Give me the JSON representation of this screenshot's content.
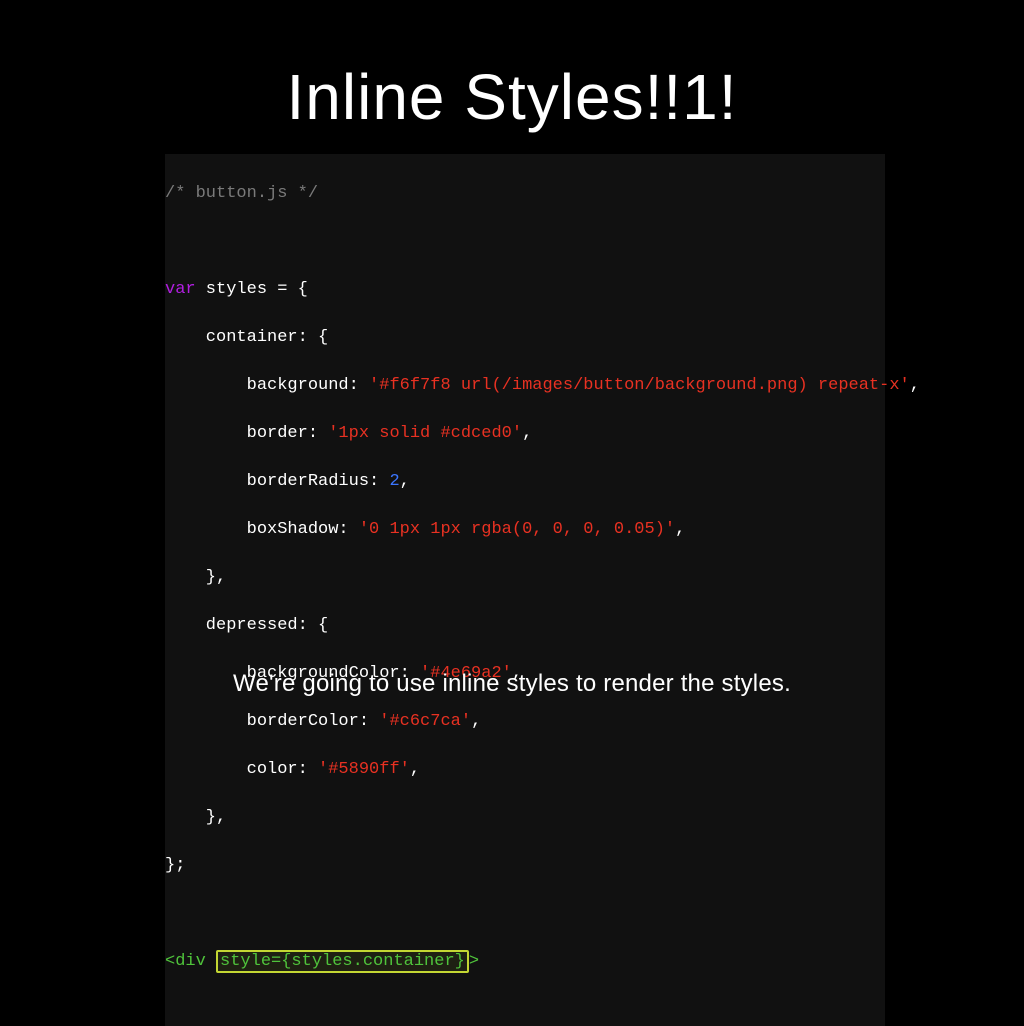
{
  "title": "Inline Styles!!1!",
  "caption": "We're going to use inline styles to render the styles.",
  "code": {
    "comment": "/* button.js */",
    "varKw": "var",
    "stylesDecl": " styles = {",
    "containerOpen": "    container: {",
    "bgKey": "        background: ",
    "bgVal": "'#f6f7f8 url(/images/button/background.png) repeat-x'",
    "borderKey": "        border: ",
    "borderVal": "'1px solid #cdced0'",
    "radiusKey": "        borderRadius: ",
    "radiusVal": "2",
    "shadowKey": "        boxShadow: ",
    "shadowVal": "'0 1px 1px rgba(0, 0, 0, 0.05)'",
    "closeObj": "    },",
    "depressedOpen": "    depressed: {",
    "bgcKey": "        backgroundColor: ",
    "bgcVal": "'#4e69a2'",
    "bcKey": "        borderColor: ",
    "bcVal": "'#c6c7ca'",
    "colorKey": "        color: ",
    "colorVal": "'#5890ff'",
    "endObj": "};",
    "jsxOpen": "<div ",
    "jsxAttr": "style={styles.container}",
    "jsxClose": ">"
  }
}
